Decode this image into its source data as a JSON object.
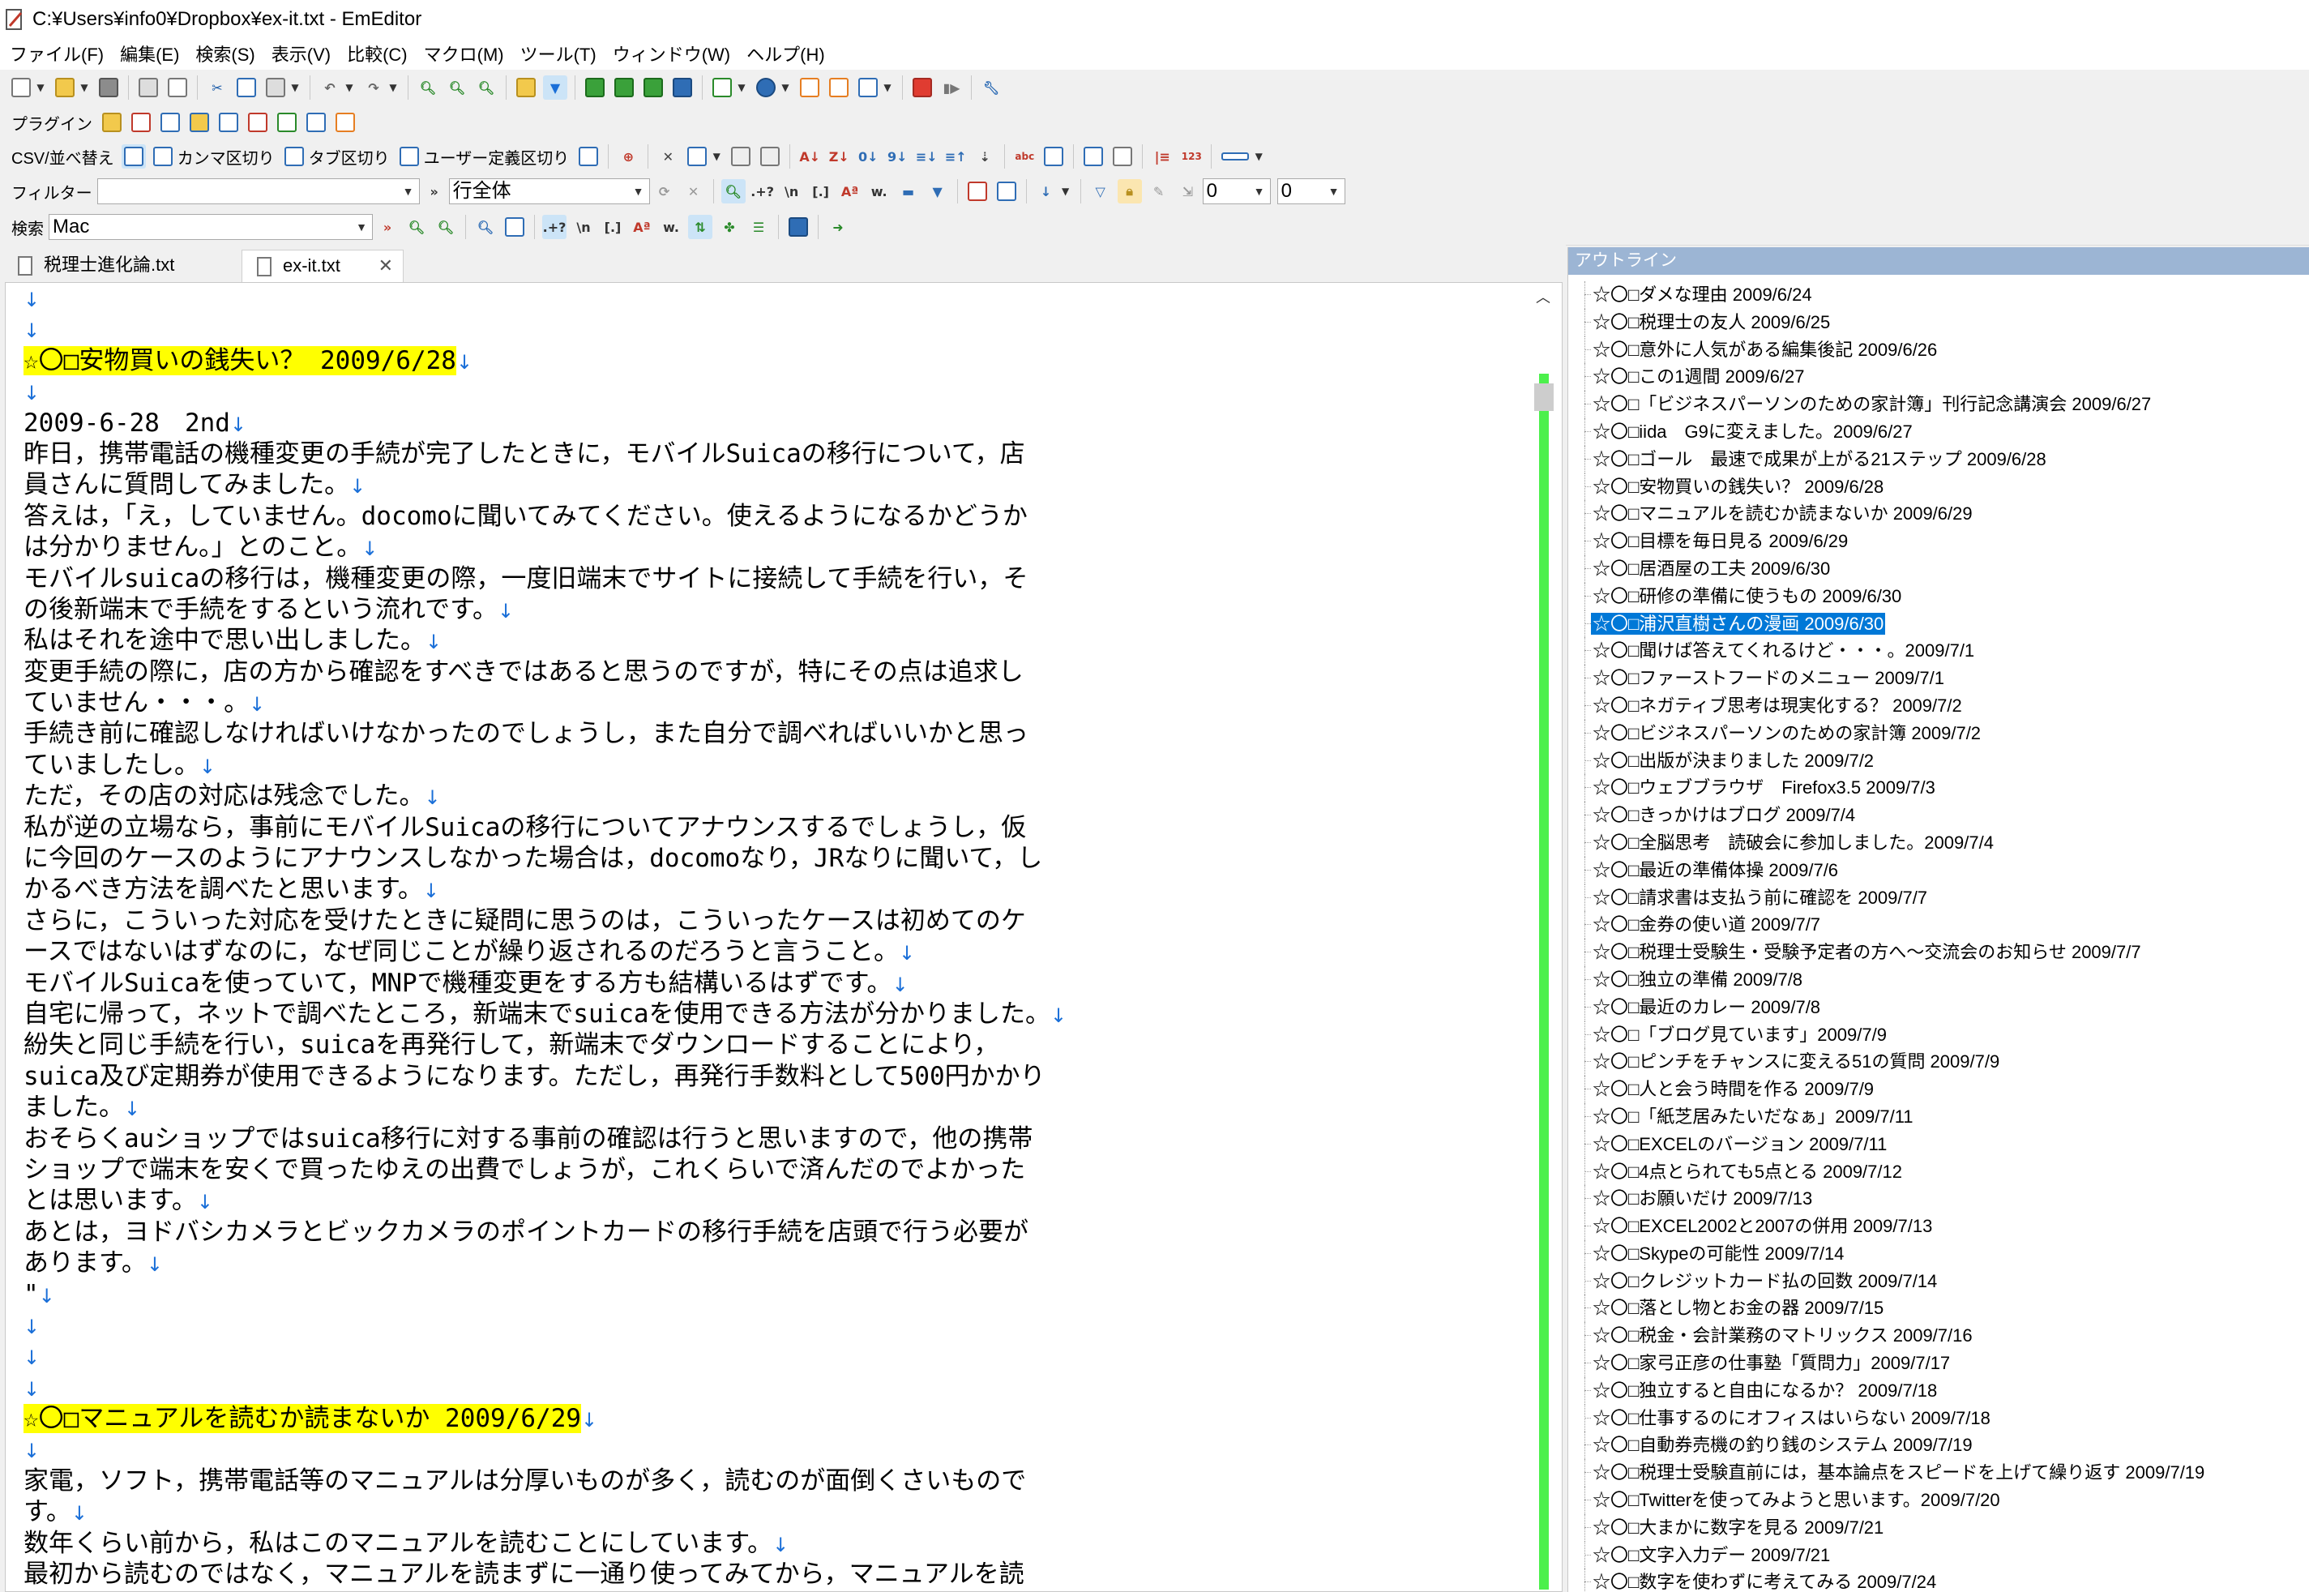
{
  "window": {
    "title": "C:¥Users¥info0¥Dropbox¥ex-it.txt - EmEditor"
  },
  "menu": [
    "ファイル(F)",
    "編集(E)",
    "検索(S)",
    "表示(V)",
    "比較(C)",
    "マクロ(M)",
    "ツール(T)",
    "ウィンドウ(W)",
    "ヘルプ(H)"
  ],
  "toolbars": {
    "plugin_label": "プラグイン",
    "csv_label": "CSV/並べ替え",
    "csv_comma": "カンマ区切り",
    "csv_tab": "タブ区切り",
    "csv_user": "ユーザー定義区切り",
    "filter_label": "フィルター",
    "filter_value": "",
    "filter_scope": "行全体",
    "filter_num1": "0",
    "filter_num2": "0",
    "search_label": "検索",
    "search_value": "Mac"
  },
  "tabs": [
    {
      "label": "税理士進化論.txt",
      "active": false
    },
    {
      "label": "ex-it.txt",
      "active": true
    }
  ],
  "editor": {
    "newline_mark": "↓",
    "lines": [
      {
        "text": "",
        "nl": true
      },
      {
        "text": "",
        "nl": true
      },
      {
        "text": "☆〇□安物買いの銭失い？ 2009/6/28",
        "nl": true,
        "highlight": true
      },
      {
        "text": "",
        "nl": true
      },
      {
        "text": "2009-6-28　2nd",
        "nl": true
      },
      {
        "text": "昨日，携帯電話の機種変更の手続が完了したときに，モバイルSuicaの移行について，店",
        "nl": false
      },
      {
        "text": "員さんに質問してみました。",
        "nl": true
      },
      {
        "text": "答えは，「え，していません。docomoに聞いてみてください。使えるようになるかどうか",
        "nl": false
      },
      {
        "text": "は分かりません。」とのこと。",
        "nl": true
      },
      {
        "text": "モバイルsuicaの移行は，機種変更の際，一度旧端末でサイトに接続して手続を行い，そ",
        "nl": false
      },
      {
        "text": "の後新端末で手続をするという流れです。",
        "nl": true
      },
      {
        "text": "私はそれを途中で思い出しました。",
        "nl": true
      },
      {
        "text": "変更手続の際に，店の方から確認をすべきではあると思うのですが，特にその点は追求し",
        "nl": false
      },
      {
        "text": "ていません・・・。",
        "nl": true
      },
      {
        "text": "手続き前に確認しなければいけなかったのでしょうし，また自分で調べればいいかと思っ",
        "nl": false
      },
      {
        "text": "ていましたし。",
        "nl": true
      },
      {
        "text": "ただ，その店の対応は残念でした。",
        "nl": true
      },
      {
        "text": "私が逆の立場なら，事前にモバイルSuicaの移行についてアナウンスするでしょうし，仮",
        "nl": false
      },
      {
        "text": "に今回のケースのようにアナウンスしなかった場合は，docomoなり，JRなりに聞いて，し",
        "nl": false
      },
      {
        "text": "かるべき方法を調べたと思います。",
        "nl": true
      },
      {
        "text": "さらに，こういった対応を受けたときに疑問に思うのは，こういったケースは初めてのケ",
        "nl": false
      },
      {
        "text": "ースではないはずなのに，なぜ同じことが繰り返されるのだろうと言うこと。",
        "nl": true
      },
      {
        "text": "モバイルSuicaを使っていて，MNPで機種変更をする方も結構いるはずです。",
        "nl": true
      },
      {
        "text": "自宅に帰って，ネットで調べたところ，新端末でsuicaを使用できる方法が分かりました。",
        "nl": true
      },
      {
        "text": "紛失と同じ手続を行い，suicaを再発行して，新端末でダウンロードすることにより，",
        "nl": false
      },
      {
        "text": "suica及び定期券が使用できるようになります。ただし，再発行手数料として500円かかり",
        "nl": false
      },
      {
        "text": "ました。",
        "nl": true
      },
      {
        "text": "おそらくauショップではsuica移行に対する事前の確認は行うと思いますので，他の携帯",
        "nl": false
      },
      {
        "text": "ショップで端末を安くで買ったゆえの出費でしょうが，これくらいで済んだのでよかった",
        "nl": false
      },
      {
        "text": "とは思います。",
        "nl": true
      },
      {
        "text": "あとは，ヨドバシカメラとビックカメラのポイントカードの移行手続を店頭で行う必要が",
        "nl": false
      },
      {
        "text": "あります。",
        "nl": true
      },
      {
        "text": "\"",
        "nl": true
      },
      {
        "text": "",
        "nl": true
      },
      {
        "text": "",
        "nl": true
      },
      {
        "text": "",
        "nl": true
      },
      {
        "text": "☆〇□マニュアルを読むか読まないか 2009/6/29",
        "nl": true,
        "highlight": true
      },
      {
        "text": "",
        "nl": true
      },
      {
        "text": "家電，ソフト，携帯電話等のマニュアルは分厚いものが多く，読むのが面倒くさいもので",
        "nl": false
      },
      {
        "text": "す。",
        "nl": true
      },
      {
        "text": "数年くらい前から，私はこのマニュアルを読むことにしています。",
        "nl": true
      },
      {
        "text": "最初から読むのではなく，マニュアルを読まずに一通り使ってみてから，マニュアルを読",
        "nl": false
      }
    ]
  },
  "outline": {
    "header": "アウトライン",
    "selected_index": 12,
    "items": [
      "☆〇□ダメな理由 2009/6/24",
      "☆〇□税理士の友人 2009/6/25",
      "☆〇□意外に人気がある編集後記 2009/6/26",
      "☆〇□この1週間 2009/6/27",
      "☆〇□「ビジネスパーソンのための家計簿」刊行記念講演会 2009/6/27",
      "☆〇□iida　G9に変えました。2009/6/27",
      "☆〇□ゴール　最速で成果が上がる21ステップ 2009/6/28",
      "☆〇□安物買いの銭失い？ 2009/6/28",
      "☆〇□マニュアルを読むか読まないか 2009/6/29",
      "☆〇□目標を毎日見る 2009/6/29",
      "☆〇□居酒屋の工夫 2009/6/30",
      "☆〇□研修の準備に使うもの 2009/6/30",
      "☆〇□浦沢直樹さんの漫画 2009/6/30",
      "☆〇□聞けば答えてくれるけど・・・。2009/7/1",
      "☆〇□ファーストフードのメニュー 2009/7/1",
      "☆〇□ネガティブ思考は現実化する？ 2009/7/2",
      "☆〇□ビジネスパーソンのための家計簿 2009/7/2",
      "☆〇□出版が決まりました 2009/7/2",
      "☆〇□ウェブブラウザ　Firefox3.5 2009/7/3",
      "☆〇□きっかけはブログ 2009/7/4",
      "☆〇□全脳思考　読破会に参加しました。2009/7/4",
      "☆〇□最近の準備体操 2009/7/6",
      "☆〇□請求書は支払う前に確認を 2009/7/7",
      "☆〇□金券の使い道 2009/7/7",
      "☆〇□税理士受験生・受験予定者の方へ～交流会のお知らせ 2009/7/7",
      "☆〇□独立の準備 2009/7/8",
      "☆〇□最近のカレー 2009/7/8",
      "☆〇□「ブログ見ています」2009/7/9",
      "☆〇□ピンチをチャンスに変える51の質問 2009/7/9",
      "☆〇□人と会う時間を作る 2009/7/9",
      "☆〇□「紙芝居みたいだなぁ」2009/7/11",
      "☆〇□EXCELのバージョン 2009/7/11",
      "☆〇□4点とられても5点とる 2009/7/12",
      "☆〇□お願いだけ 2009/7/13",
      "☆〇□EXCEL2002と2007の併用 2009/7/13",
      "☆〇□Skypeの可能性 2009/7/14",
      "☆〇□クレジットカード払の回数 2009/7/14",
      "☆〇□落とし物とお金の器 2009/7/15",
      "☆〇□税金・会計業務のマトリックス 2009/7/16",
      "☆〇□家弓正彦の仕事塾「質問力」2009/7/17",
      "☆〇□独立すると自由になるか？ 2009/7/18",
      "☆〇□仕事するのにオフィスはいらない 2009/7/18",
      "☆〇□自動券売機の釣り銭のシステム 2009/7/19",
      "☆〇□税理士受験直前には，基本論点をスピードを上げて繰り返す 2009/7/19",
      "☆〇□Twitterを使ってみようと思います。2009/7/20",
      "☆〇□大まかに数字を見る 2009/7/21",
      "☆〇□文字入力デー 2009/7/21",
      "☆〇□数字を使わずに考えてみる 2009/7/24"
    ]
  },
  "colors": {
    "highlight": "#ffff00",
    "newline": "#1a6fd8",
    "selection": "#0078d7",
    "scrollbar_marker": "#4cf04c",
    "outline_header": "#9cb5d4"
  },
  "icons": [
    "app-icon",
    "new-icon",
    "open-icon",
    "save-icon",
    "print-icon",
    "cut-icon",
    "copy-icon",
    "paste-icon",
    "undo-icon",
    "redo-icon",
    "find-icon",
    "filter-icon",
    "plugin-icon",
    "search-next-icon",
    "close-icon"
  ]
}
